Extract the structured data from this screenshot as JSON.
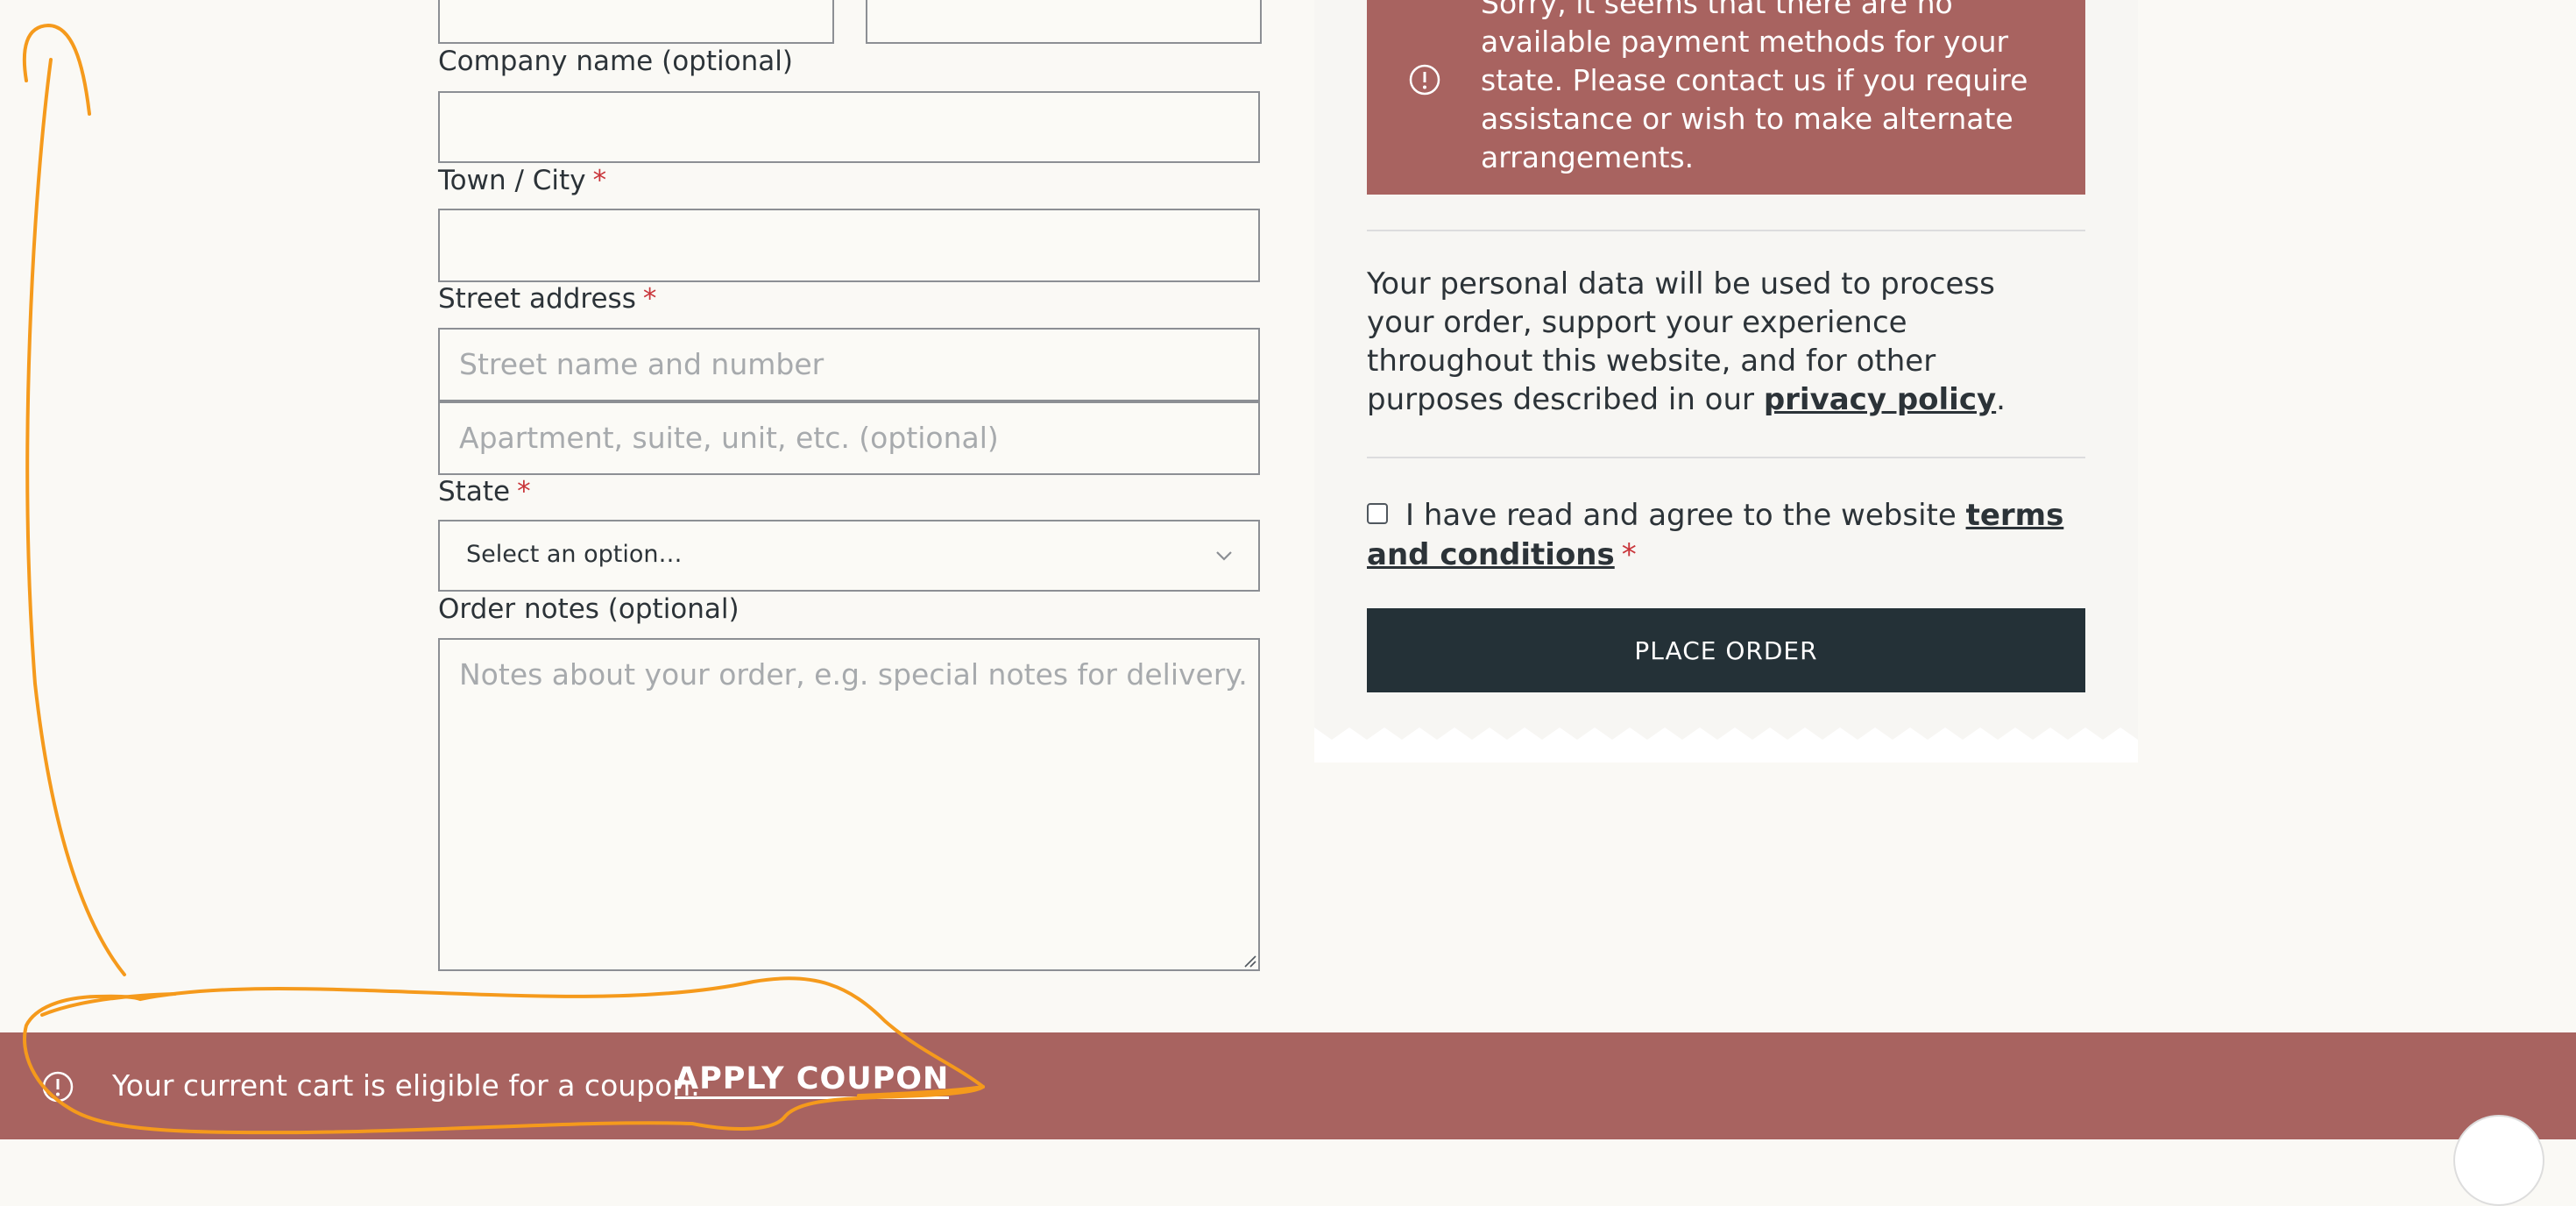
{
  "form": {
    "company_label": "Company name (optional)",
    "town_label": "Town / City",
    "street_label": "Street address",
    "street_placeholder_1": "Street name and number",
    "street_placeholder_2": "Apartment, suite, unit, etc. (optional)",
    "state_label": "State",
    "state_value": "Select an option…",
    "notes_label": "Order notes (optional)",
    "notes_placeholder": "Notes about your order, e.g. special notes for delivery.",
    "required_marker": "*"
  },
  "payment_alert": {
    "text": "Sorry, it seems that there are no available payment methods for your state. Please contact us if you require assistance or wish to make alternate arrangements."
  },
  "privacy": {
    "text_before": "Your personal data will be used to process your order, support your experience throughout this website, and for other purposes described in our ",
    "link": "privacy policy",
    "text_after": "."
  },
  "terms": {
    "text_before": "I have read and agree to the website ",
    "link": "terms and conditions",
    "required_marker": "*"
  },
  "place_order_label": "PLACE ORDER",
  "coupon_banner": {
    "text": "Your current cart is eligible for a coupon.",
    "link": "APPLY COUPON"
  },
  "icons": {
    "alert": "exclamation-circle-icon",
    "dropdown": "chevron-down-icon"
  },
  "colors": {
    "alert_bg": "#a86360",
    "button_bg": "#243137",
    "required": "#c9353a",
    "annotation": "#f59a1c"
  }
}
